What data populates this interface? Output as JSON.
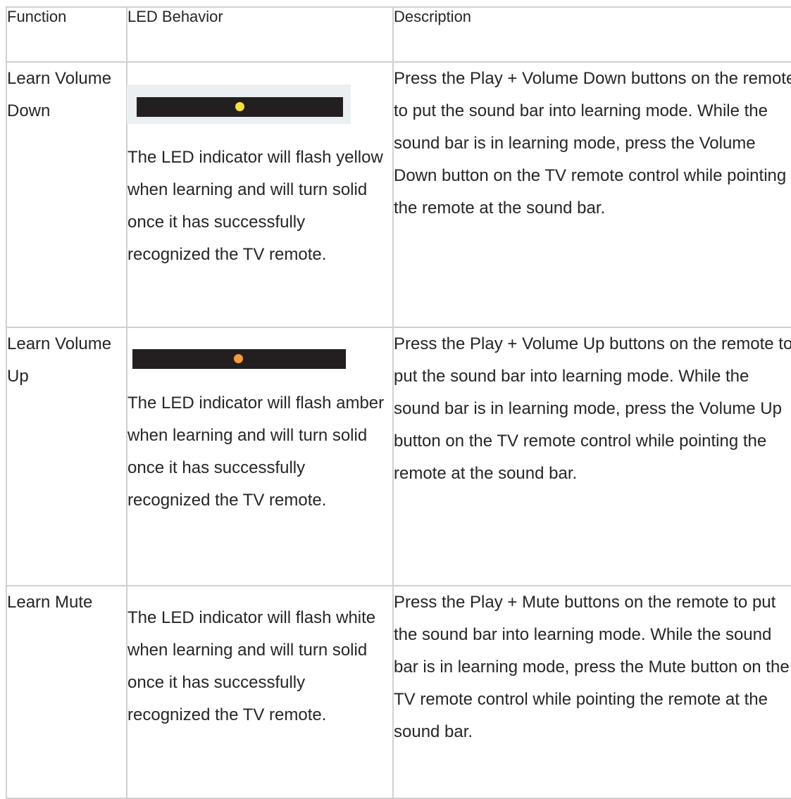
{
  "table": {
    "headers": [
      "Function",
      "LED Behavior",
      "Description"
    ],
    "rows": [
      {
        "function": "Learn Volume Down",
        "led_color": "#f3e23a",
        "led_color_name": "yellow",
        "led_behavior": "The LED indicator will flash yellow when learning and will turn solid once it has successfully recognized the TV remote.",
        "description": "Press the Play + Volume Down buttons on the remote to put the sound bar into learning mode. While the sound bar is in learning mode, press the Volume Down button on the TV remote control while pointing the remote at the sound bar."
      },
      {
        "function": "Learn Volume Up",
        "led_color": "#f49a3a",
        "led_color_name": "amber",
        "led_behavior": "The LED indicator will flash amber when learning and will turn solid once it has successfully recognized the TV remote.",
        "description": "Press the Play + Volume Up buttons on the remote to put the sound bar into learning mode. While the sound bar is in learning mode, press the Volume Up button on the TV remote control while pointing the remote at the sound bar."
      },
      {
        "function": "Learn Mute",
        "led_behavior": "The LED indicator will flash white when learning and will turn solid once it has successfully recognized the TV remote.",
        "description": "Press the Play + Mute buttons on the remote to put the sound bar into learning mode. While the sound bar is in learning mode, press the Mute button on the TV remote control while pointing the remote at the sound bar."
      }
    ]
  }
}
